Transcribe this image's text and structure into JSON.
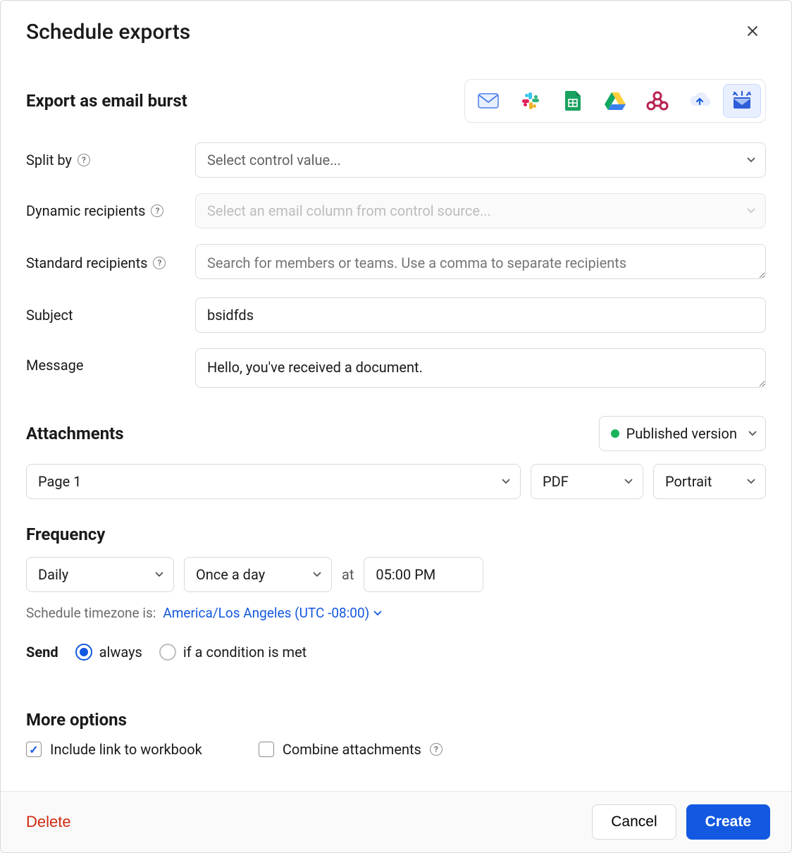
{
  "dialog": {
    "title": "Schedule exports"
  },
  "section": {
    "title": "Export as email burst"
  },
  "destinations": {
    "items": [
      {
        "name": "email",
        "active": false
      },
      {
        "name": "slack",
        "active": false
      },
      {
        "name": "google-sheets",
        "active": false
      },
      {
        "name": "google-drive",
        "active": false
      },
      {
        "name": "webhook",
        "active": false
      },
      {
        "name": "cloud-storage",
        "active": false
      },
      {
        "name": "email-burst",
        "active": true
      }
    ]
  },
  "fields": {
    "split_by": {
      "label": "Split by",
      "placeholder": "Select control value...",
      "value": ""
    },
    "dynamic_recipients": {
      "label": "Dynamic recipients",
      "placeholder": "Select an email column from control source...",
      "value": "",
      "disabled": true
    },
    "standard_recipients": {
      "label": "Standard recipients",
      "placeholder": "Search for members or teams. Use a comma to separate recipients",
      "value": ""
    },
    "subject": {
      "label": "Subject",
      "value": "bsidfds"
    },
    "message": {
      "label": "Message",
      "value": "Hello, you've received a document."
    }
  },
  "attachments": {
    "title": "Attachments",
    "version": {
      "label": "Published version",
      "status": "published"
    },
    "element": {
      "value": "Page 1"
    },
    "format": {
      "value": "PDF"
    },
    "orientation": {
      "value": "Portrait"
    }
  },
  "frequency": {
    "title": "Frequency",
    "interval": "Daily",
    "times_per": "Once a day",
    "at_label": "at",
    "time": "05:00 PM",
    "tz_label": "Schedule timezone is:",
    "tz_value": "America/Los Angeles (UTC -08:00)"
  },
  "send": {
    "label": "Send",
    "options": [
      {
        "label": "always",
        "selected": true
      },
      {
        "label": "if a condition is met",
        "selected": false
      }
    ]
  },
  "more": {
    "title": "More options",
    "include_link": {
      "label": "Include link to workbook",
      "checked": true
    },
    "combine": {
      "label": "Combine attachments",
      "checked": false
    }
  },
  "footer": {
    "delete": "Delete",
    "cancel": "Cancel",
    "create": "Create"
  }
}
